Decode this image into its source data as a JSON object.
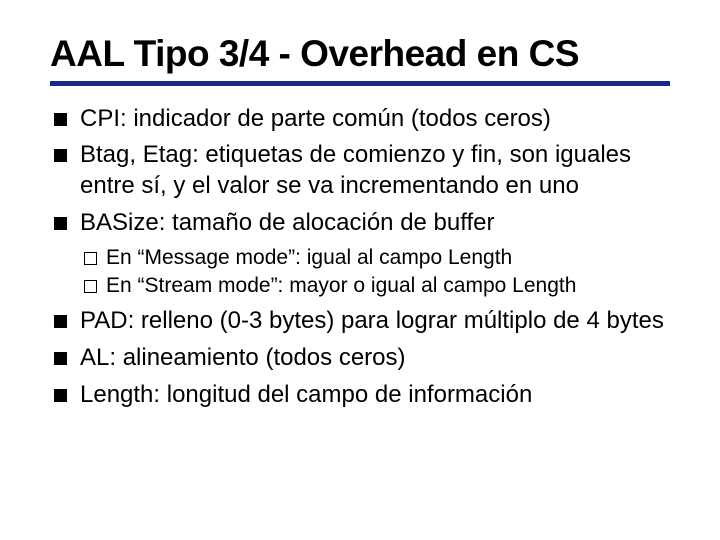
{
  "title": "AAL Tipo 3/4  - Overhead en CS",
  "bullets": [
    {
      "text": "CPI: indicador de parte común (todos ceros)"
    },
    {
      "text": "Btag, Etag: etiquetas de comienzo y fin, son iguales entre sí, y el valor se va incrementando en uno"
    },
    {
      "text": "BASize: tamaño de alocación de buffer",
      "sub": [
        {
          "text": "En “Message mode”: igual al campo Length"
        },
        {
          "text": "En “Stream mode”: mayor o igual al campo Length"
        }
      ]
    },
    {
      "text": "PAD: relleno (0-3 bytes) para lograr múltiplo de 4 bytes"
    },
    {
      "text": "AL: alineamiento (todos ceros)"
    },
    {
      "text": "Length: longitud del campo de información"
    }
  ]
}
